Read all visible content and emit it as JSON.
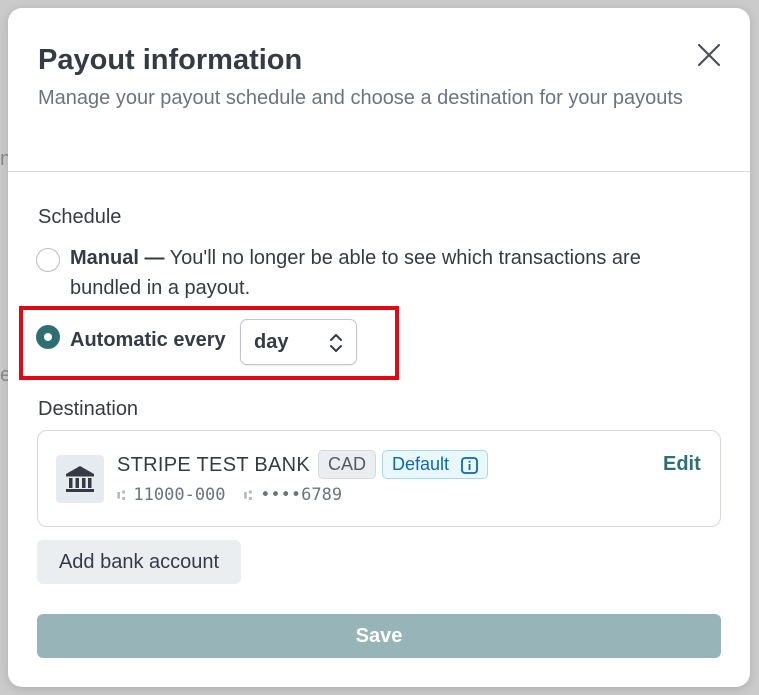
{
  "background": {
    "left_glyph_1": "n",
    "left_glyph_2": "e"
  },
  "modal": {
    "title": "Payout information",
    "subtitle": "Manage your payout schedule and choose a destination for your payouts",
    "close_icon": "close-icon"
  },
  "schedule": {
    "label": "Schedule",
    "manual": {
      "bold_label": "Manual —",
      "description": " You'll no longer be able to see which transactions are bundled in a payout.",
      "selected": false
    },
    "automatic": {
      "label": "Automatic every",
      "selected": true,
      "interval_value": "day"
    }
  },
  "destination": {
    "label": "Destination",
    "bank": {
      "icon": "bank-icon",
      "name": "STRIPE TEST BANK",
      "currency_badge": "CAD",
      "default_badge": "Default",
      "routing": "11000-000",
      "account": "••••6789",
      "edit_label": "Edit"
    },
    "add_bank_label": "Add bank account"
  },
  "save_label": "Save",
  "colors": {
    "accent": "#2f6f73",
    "save_disabled": "#97b5b8",
    "highlight": "#e30613",
    "default_badge": "#0a69b3"
  }
}
